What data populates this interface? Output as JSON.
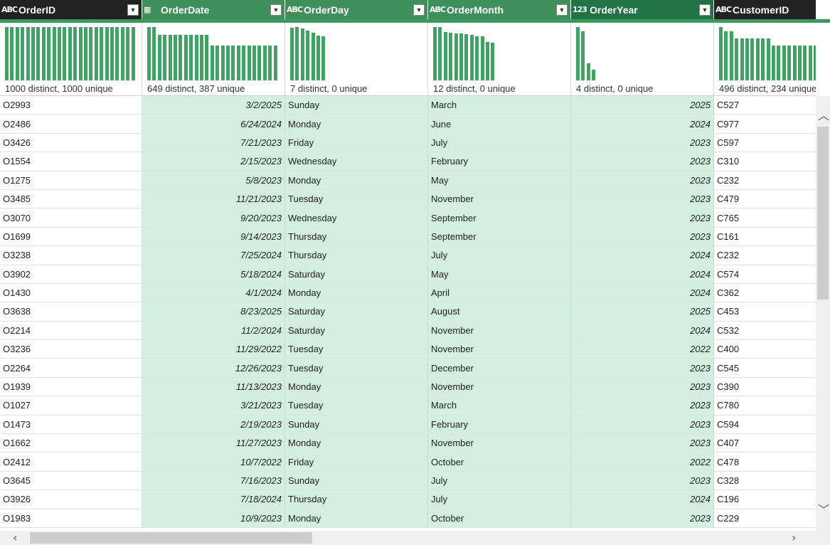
{
  "columns": [
    {
      "name": "OrderID",
      "type_icon": "text-type-icon",
      "type_glyph": "ABC",
      "profile": "1000 distinct, 1000 unique",
      "hist": [
        1,
        1,
        1,
        1,
        1,
        1,
        1,
        1,
        1,
        1,
        1,
        1,
        1,
        1,
        1,
        1,
        1,
        1,
        1,
        1,
        1,
        1,
        1,
        1,
        1
      ],
      "selected": false,
      "style": "dark"
    },
    {
      "name": "OrderDate",
      "type_icon": "date-type-icon",
      "type_glyph": "▦",
      "profile": "649 distinct, 387 unique",
      "hist": [
        1,
        1,
        0.85,
        0.85,
        0.85,
        0.85,
        0.85,
        0.85,
        0.85,
        0.85,
        0.85,
        0.85,
        0.65,
        0.65,
        0.65,
        0.65,
        0.65,
        0.65,
        0.65,
        0.65,
        0.65,
        0.65,
        0.65,
        0.65,
        0.65
      ],
      "selected": true,
      "style": "green"
    },
    {
      "name": "OrderDay",
      "type_icon": "text-type-icon",
      "type_glyph": "ABC",
      "profile": "7 distinct, 0 unique",
      "hist": [
        0.99,
        1,
        0.98,
        0.93,
        0.89,
        0.84,
        0.83
      ],
      "selected": true,
      "style": "green"
    },
    {
      "name": "OrderMonth",
      "type_icon": "text-type-icon",
      "type_glyph": "ABC",
      "profile": "12 distinct, 0 unique",
      "hist": [
        1,
        1,
        0.91,
        0.9,
        0.88,
        0.88,
        0.87,
        0.86,
        0.83,
        0.83,
        0.72,
        0.71
      ],
      "selected": true,
      "style": "green"
    },
    {
      "name": "OrderYear",
      "type_icon": "number-type-icon",
      "type_glyph": "123",
      "profile": "4 distinct, 0 unique",
      "hist": [
        1,
        0.92,
        0.32,
        0.2
      ],
      "selected": true,
      "style": "deep"
    },
    {
      "name": "CustomerID",
      "type_icon": "text-type-icon",
      "type_glyph": "ABC",
      "profile": "496 distinct, 234 unique",
      "hist": [
        1,
        0.92,
        0.92,
        0.79,
        0.79,
        0.79,
        0.79,
        0.79,
        0.79,
        0.79,
        0.66,
        0.66,
        0.66,
        0.66,
        0.66,
        0.66,
        0.66,
        0.66,
        0.66,
        0.66
      ],
      "selected": false,
      "style": "dark"
    }
  ],
  "rows": [
    [
      "O2993",
      "3/2/2025",
      "Sunday",
      "March",
      "2025",
      "C527"
    ],
    [
      "O2486",
      "6/24/2024",
      "Monday",
      "June",
      "2024",
      "C977"
    ],
    [
      "O3426",
      "7/21/2023",
      "Friday",
      "July",
      "2023",
      "C597"
    ],
    [
      "O1554",
      "2/15/2023",
      "Wednesday",
      "February",
      "2023",
      "C310"
    ],
    [
      "O1275",
      "5/8/2023",
      "Monday",
      "May",
      "2023",
      "C232"
    ],
    [
      "O3485",
      "11/21/2023",
      "Tuesday",
      "November",
      "2023",
      "C479"
    ],
    [
      "O3070",
      "9/20/2023",
      "Wednesday",
      "September",
      "2023",
      "C765"
    ],
    [
      "O1699",
      "9/14/2023",
      "Thursday",
      "September",
      "2023",
      "C161"
    ],
    [
      "O3238",
      "7/25/2024",
      "Thursday",
      "July",
      "2024",
      "C232"
    ],
    [
      "O3902",
      "5/18/2024",
      "Saturday",
      "May",
      "2024",
      "C574"
    ],
    [
      "O1430",
      "4/1/2024",
      "Monday",
      "April",
      "2024",
      "C362"
    ],
    [
      "O3638",
      "8/23/2025",
      "Saturday",
      "August",
      "2025",
      "C453"
    ],
    [
      "O2214",
      "11/2/2024",
      "Saturday",
      "November",
      "2024",
      "C532"
    ],
    [
      "O3236",
      "11/29/2022",
      "Tuesday",
      "November",
      "2022",
      "C400"
    ],
    [
      "O2264",
      "12/26/2023",
      "Tuesday",
      "December",
      "2023",
      "C545"
    ],
    [
      "O1939",
      "11/13/2023",
      "Monday",
      "November",
      "2023",
      "C390"
    ],
    [
      "O1027",
      "3/21/2023",
      "Tuesday",
      "March",
      "2023",
      "C780"
    ],
    [
      "O1473",
      "2/19/2023",
      "Sunday",
      "February",
      "2023",
      "C594"
    ],
    [
      "O1662",
      "11/27/2023",
      "Monday",
      "November",
      "2023",
      "C407"
    ],
    [
      "O2412",
      "10/7/2022",
      "Friday",
      "October",
      "2022",
      "C478"
    ],
    [
      "O3645",
      "7/16/2023",
      "Sunday",
      "July",
      "2023",
      "C328"
    ],
    [
      "O3926",
      "7/18/2024",
      "Thursday",
      "July",
      "2024",
      "C196"
    ],
    [
      "O1983",
      "10/9/2023",
      "Monday",
      "October",
      "2023",
      "C229"
    ]
  ],
  "colors": {
    "header_dark": "#222222",
    "header_selected": "#3f8f5b",
    "header_active": "#217346",
    "selection_fill": "#d3efdf",
    "histogram_bar": "#3fa364"
  }
}
